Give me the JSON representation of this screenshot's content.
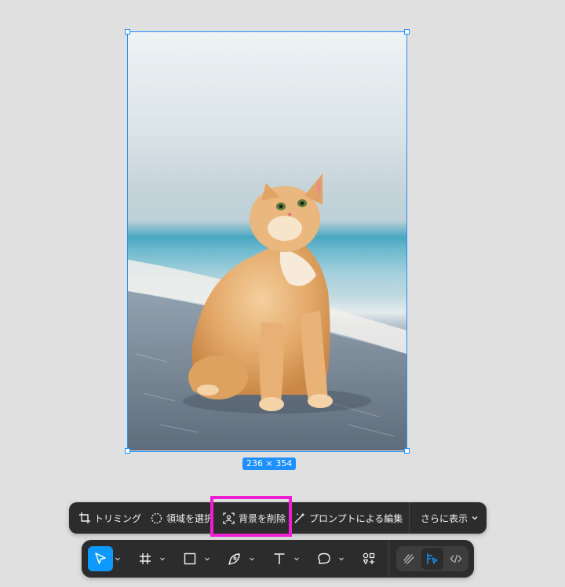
{
  "canvas": {
    "image_name": "cat-photo",
    "size_label": "236 × 354"
  },
  "context_toolbar": {
    "crop_label": "トリミング",
    "select_region_label": "領域を選択",
    "remove_background_label": "背景を削除",
    "prompt_edit_label": "プロンプトによる編集",
    "more_label": "さらに表示"
  },
  "main_toolbar": {
    "tools": [
      {
        "name": "move-tool",
        "icon": "cursor-icon",
        "active": true
      },
      {
        "name": "frame-tool",
        "icon": "hash-icon",
        "active": false
      },
      {
        "name": "shape-tool",
        "icon": "square-icon",
        "active": false
      },
      {
        "name": "pen-tool",
        "icon": "pen-icon",
        "active": false
      },
      {
        "name": "text-tool",
        "icon": "text-icon",
        "active": false
      },
      {
        "name": "comment-tool",
        "icon": "comment-icon",
        "active": false
      },
      {
        "name": "actions-tool",
        "icon": "actions-icon",
        "active": false
      }
    ],
    "modes": [
      {
        "name": "draw-mode",
        "icon": "draw-icon",
        "active": false
      },
      {
        "name": "design-mode",
        "icon": "design-icon",
        "active": true
      },
      {
        "name": "dev-mode",
        "icon": "code-icon",
        "active": false
      }
    ]
  },
  "colors": {
    "selection": "#1e90ff",
    "toolbar_bg": "#2c2c2c",
    "active_tool": "#0d99ff",
    "highlight_box": "#ee1fd2"
  }
}
